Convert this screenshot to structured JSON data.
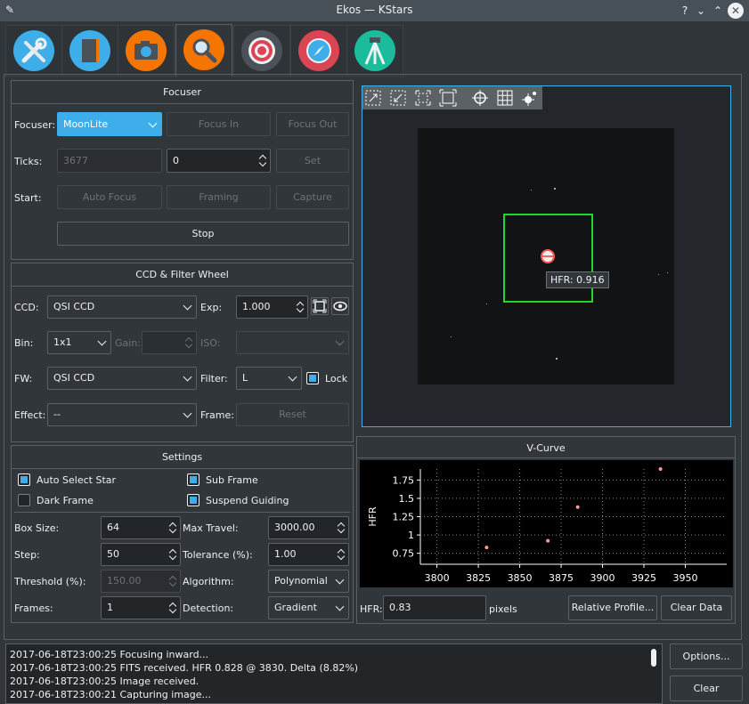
{
  "window": {
    "title": "Ekos — KStars"
  },
  "titlebar_buttons": [
    "?",
    "⌄",
    "⌃",
    "✕"
  ],
  "tabs": [
    {
      "name": "setup-tab",
      "icon": "wrench-screwdriver-icon",
      "color": "#3daee9"
    },
    {
      "name": "scheduler-tab",
      "icon": "notebook-icon",
      "color": "#3daee9"
    },
    {
      "name": "capture-tab",
      "icon": "camera-icon",
      "color": "#f67400"
    },
    {
      "name": "focus-tab",
      "icon": "magnifier-icon",
      "color": "#f67400"
    },
    {
      "name": "align-tab",
      "icon": "target-icon",
      "color": "#da4453"
    },
    {
      "name": "guide-tab",
      "icon": "compass-icon",
      "color": "#da4453"
    },
    {
      "name": "mount-tab",
      "icon": "telescope-icon",
      "color": "#1abc9c"
    }
  ],
  "focuser": {
    "title": "Focuser",
    "focuser_label": "Focuser:",
    "focuser_value": "MoonLite",
    "focus_in": "Focus In",
    "focus_out": "Focus Out",
    "ticks_label": "Ticks:",
    "ticks_value": "3677",
    "ticks_target": "0",
    "set": "Set",
    "start_label": "Start:",
    "auto_focus": "Auto Focus",
    "framing": "Framing",
    "capture": "Capture",
    "stop": "Stop"
  },
  "ccd": {
    "title": "CCD & Filter Wheel",
    "ccd_label": "CCD:",
    "ccd_value": "QSI CCD",
    "exp_label": "Exp:",
    "exp_value": "1.000",
    "bin_label": "Bin:",
    "bin_value": "1x1",
    "gain_label": "Gain:",
    "iso_label": "ISO:",
    "fw_label": "FW:",
    "fw_value": "QSI CCD",
    "filter_label": "Filter:",
    "filter_value": "L",
    "lock_label": "Lock",
    "effect_label": "Effect:",
    "effect_value": "--",
    "frame_label": "Frame:",
    "reset": "Reset"
  },
  "settings": {
    "title": "Settings",
    "auto_select_star": "Auto Select Star",
    "sub_frame": "Sub Frame",
    "dark_frame": "Dark Frame",
    "suspend_guiding": "Suspend Guiding",
    "box_size_label": "Box Size:",
    "box_size_value": "64",
    "max_travel_label": "Max Travel:",
    "max_travel_value": "3000.00",
    "step_label": "Step:",
    "step_value": "50",
    "tolerance_label": "Tolerance (%):",
    "tolerance_value": "1.00",
    "threshold_label": "Threshold (%):",
    "threshold_value": "150.00",
    "algorithm_label": "Algorithm:",
    "algorithm_value": "Polynomial",
    "frames_label": "Frames:",
    "frames_value": "1",
    "detection_label": "Detection:",
    "detection_value": "Gradient"
  },
  "fits": {
    "hfr_tooltip": "HFR: 0.916"
  },
  "vcurve": {
    "title": "V-Curve",
    "hfr_label": "HFR:",
    "hfr_value": "0.83",
    "pixels_label": "pixels",
    "relative_profile": "Relative Profile...",
    "clear_data": "Clear Data"
  },
  "chart_data": {
    "type": "scatter",
    "title": "",
    "xlabel": "",
    "ylabel": "HFR",
    "xlim": [
      3790,
      3975
    ],
    "ylim": [
      0.6,
      1.9
    ],
    "x_ticks": [
      "3800",
      "3825",
      "3850",
      "3875",
      "3900",
      "3925",
      "3950"
    ],
    "y_ticks": [
      "1.75",
      "1.5",
      "1.25",
      "1",
      "0.75"
    ],
    "grid": true,
    "points": [
      {
        "x": 3830,
        "y": 0.83
      },
      {
        "x": 3867,
        "y": 0.92
      },
      {
        "x": 3885,
        "y": 1.38
      },
      {
        "x": 3935,
        "y": 1.9
      }
    ],
    "point_color": "#ff9999"
  },
  "log": {
    "lines": [
      "2017-06-18T23:00:25 Focusing inward...",
      "2017-06-18T23:00:25 FITS received. HFR 0.828 @ 3830. Delta (8.82%)",
      "2017-06-18T23:00:25 Image received.",
      "2017-06-18T23:00:21 Capturing image..."
    ]
  },
  "bottom_buttons": {
    "options": "Options...",
    "clear": "Clear"
  }
}
